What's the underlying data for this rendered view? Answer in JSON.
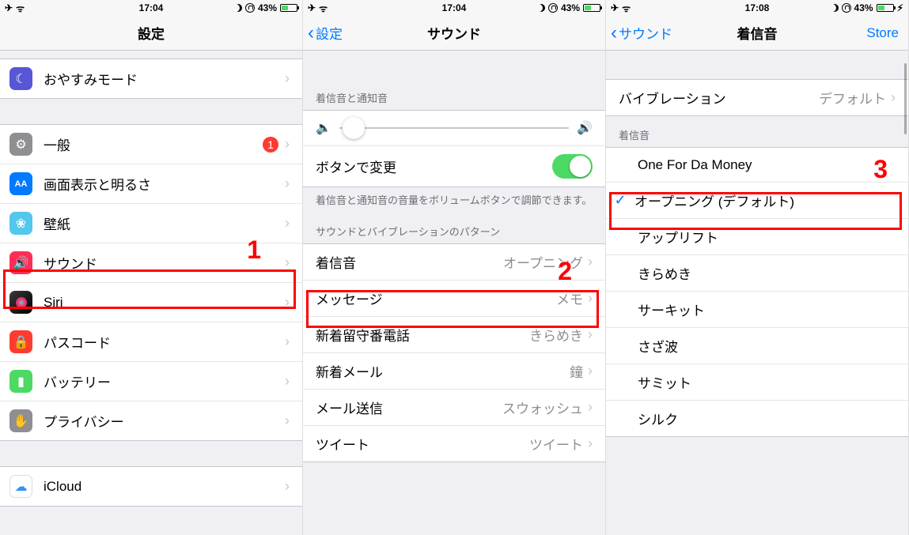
{
  "status": {
    "time1": "17:04",
    "time2": "17:04",
    "time3": "17:08",
    "battery_pct": "43%",
    "airplane_icon": "✈︎",
    "wifi_icon": "ᯤ",
    "charge_icon": "⚡︎"
  },
  "screen1": {
    "title": "設定",
    "cells": {
      "dnd": "おやすみモード",
      "general": "一般",
      "general_badge": "1",
      "display": "画面表示と明るさ",
      "wallpaper": "壁紙",
      "sounds": "サウンド",
      "siri": "Siri",
      "passcode": "パスコード",
      "battery": "バッテリー",
      "privacy": "プライバシー",
      "icloud": "iCloud"
    },
    "step": "1"
  },
  "screen2": {
    "back": "設定",
    "title": "サウンド",
    "header1": "着信音と通知音",
    "change_with_buttons": "ボタンで変更",
    "footer1": "着信音と通知音の音量をボリュームボタンで調節できます。",
    "header2": "サウンドとバイブレーションのパターン",
    "rows": {
      "ringtone_label": "着信音",
      "ringtone_value": "オープニング",
      "message_label": "メッセージ",
      "message_value": "メモ",
      "voicemail_label": "新着留守番電話",
      "voicemail_value": "きらめき",
      "newmail_label": "新着メール",
      "newmail_value": "鐘",
      "sentmail_label": "メール送信",
      "sentmail_value": "スウォッシュ",
      "tweet_label": "ツイート",
      "tweet_value": "ツイート"
    },
    "step": "2"
  },
  "screen3": {
    "back": "サウンド",
    "title": "着信音",
    "store": "Store",
    "vibration_label": "バイブレーション",
    "vibration_value": "デフォルト",
    "header": "着信音",
    "tones": {
      "custom": "One For Da Money",
      "default": "オープニング (デフォルト)",
      "t1": "アップリフト",
      "t2": "きらめき",
      "t3": "サーキット",
      "t4": "さざ波",
      "t5": "サミット",
      "t6": "シルク"
    },
    "step": "3"
  }
}
